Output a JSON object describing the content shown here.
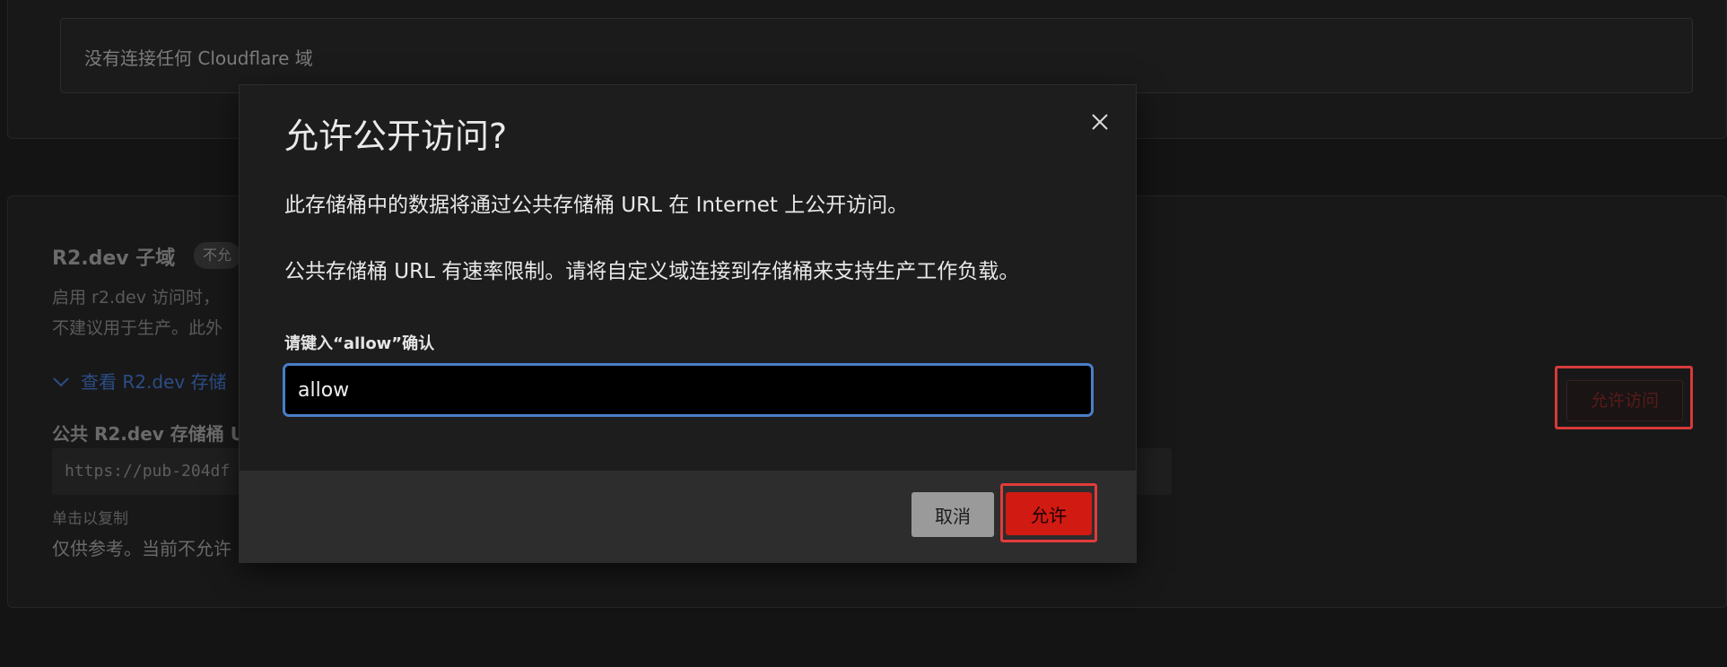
{
  "background": {
    "domains_card": {
      "empty_text": "没有连接任何 Cloudflare 域"
    },
    "r2dev_card": {
      "title": "R2.dev 子域",
      "badge": "不允",
      "description_line1": "启用 r2.dev 访问时，",
      "description_line2": "不建议用于生产。此外",
      "description_tail": "，",
      "view_link": "查看 R2.dev 存储",
      "url_label": "公共 R2.dev 存储桶 U",
      "url_value": "https://pub-204df",
      "copy_hint": "单击以复制",
      "note": "仅供参考。当前不允许",
      "allow_access_button": "允许访问"
    }
  },
  "modal": {
    "title": "允许公开访问?",
    "paragraph1": "此存储桶中的数据将通过公共存储桶 URL 在 Internet 上公开访问。",
    "paragraph2": "公共存储桶 URL 有速率限制。请将自定义域连接到存储桶来支持生产工作负载。",
    "input_label": "请键入“allow”确认",
    "input_value": "allow",
    "cancel_label": "取消",
    "allow_label": "允许"
  },
  "colors": {
    "highlight": "#e23b3b",
    "allow_button": "#d01a12",
    "input_focus": "#4a7ec7"
  }
}
